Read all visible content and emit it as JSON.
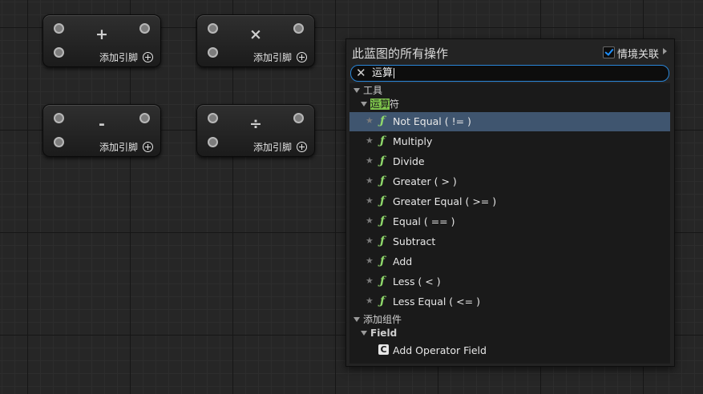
{
  "nodes": [
    {
      "symbol": "+",
      "add_pin_label": "添加引脚"
    },
    {
      "symbol": "×",
      "add_pin_label": "添加引脚"
    },
    {
      "symbol": "-",
      "add_pin_label": "添加引脚"
    },
    {
      "symbol": "÷",
      "add_pin_label": "添加引脚"
    }
  ],
  "menu": {
    "title": "此蓝图的所有操作",
    "context_label": "情境关联",
    "context_checked": true,
    "search_value": "运算",
    "tree": {
      "category": "工具",
      "subcategory_highlight": "运算",
      "subcategory_rest": "符",
      "items": [
        {
          "label": "Not Equal ( != )",
          "selected": true
        },
        {
          "label": "Multiply"
        },
        {
          "label": "Divide"
        },
        {
          "label": "Greater ( > )"
        },
        {
          "label": "Greater Equal ( >= )"
        },
        {
          "label": "Equal ( == )"
        },
        {
          "label": "Subtract"
        },
        {
          "label": "Add"
        },
        {
          "label": "Less ( < )"
        },
        {
          "label": "Less Equal ( <= )"
        }
      ],
      "category2": "添加组件",
      "subcategory2": "Field",
      "component_item": "Add Operator Field"
    }
  },
  "colors": {
    "selection": "#3f556f",
    "highlight": "#7ec44c",
    "function_icon": "#8fd96b",
    "search_border": "#2a86d8",
    "checkbox_mark": "#1e8fff"
  },
  "icons": {
    "item_star": "star-icon",
    "function": "function-icon",
    "component": "component-icon",
    "clear": "close-icon"
  }
}
